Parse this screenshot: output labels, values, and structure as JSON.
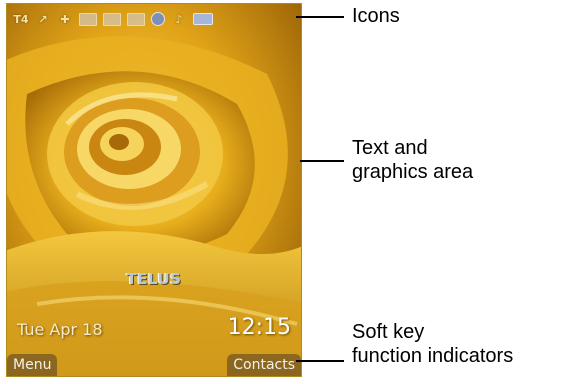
{
  "phone": {
    "status_icons": [
      {
        "name": "signal-strength-icon",
        "text": "T4"
      },
      {
        "name": "call-forward-icon",
        "text": "↗"
      },
      {
        "name": "network-icon",
        "text": "✚"
      },
      {
        "name": "message-icon",
        "text": ""
      },
      {
        "name": "email-icon",
        "text": ""
      },
      {
        "name": "voicemail-icon",
        "text": ""
      },
      {
        "name": "bluetooth-icon",
        "text": ""
      },
      {
        "name": "ringtone-icon",
        "text": "♪"
      },
      {
        "name": "battery-icon",
        "text": ""
      }
    ],
    "carrier": "TELUS",
    "date": "Tue Apr 18",
    "time": "12:15",
    "softkey_left": "Menu",
    "softkey_right": "Contacts"
  },
  "callouts": {
    "icons": "Icons",
    "text_area": "Text and\ngraphics area",
    "soft_keys": "Soft key\nfunction indicators"
  },
  "colors": {
    "rose_light": "#f6d35a",
    "rose_mid": "#e2a817",
    "rose_dark": "#8a5a06",
    "background": "#ffffff"
  }
}
